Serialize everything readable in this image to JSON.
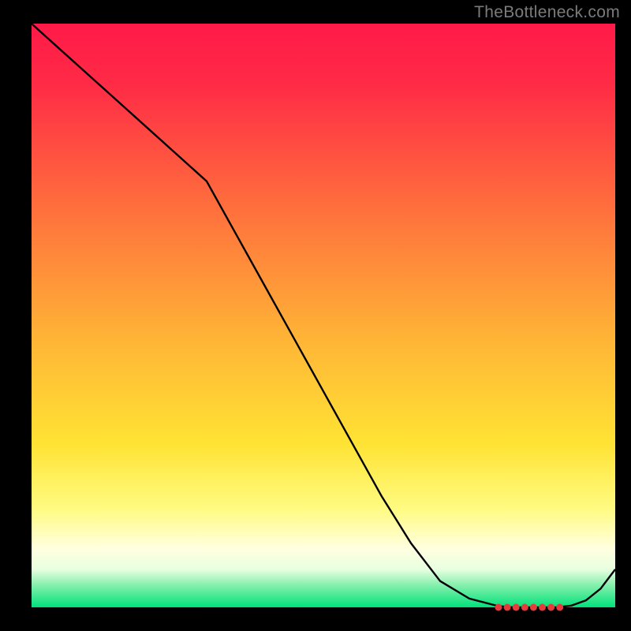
{
  "attribution": "TheBottleneck.com",
  "chart_data": {
    "type": "line",
    "title": "",
    "xlabel": "",
    "ylabel": "",
    "x": [
      0,
      5,
      10,
      15,
      20,
      25,
      30,
      35,
      40,
      45,
      50,
      55,
      60,
      65,
      70,
      75,
      80,
      82.5,
      85,
      87.5,
      90,
      92.5,
      95,
      97.5,
      100
    ],
    "y": [
      100,
      95.5,
      91,
      86.5,
      82,
      77.5,
      73,
      64,
      55,
      46,
      37,
      28,
      19,
      11,
      4.5,
      1.5,
      0.2,
      0,
      0,
      0,
      0,
      0.3,
      1.2,
      3.2,
      6.5
    ],
    "ylim": [
      0,
      100
    ],
    "xlim": [
      0,
      100
    ],
    "valley_markers_x": [
      80,
      81.5,
      83,
      84.5,
      86,
      87.5,
      89,
      90.5
    ],
    "valley_markers_y": 0,
    "marker_color": "#e63b3b",
    "curve_color": "#000000",
    "gradient_stops": [
      {
        "pos": 0.0,
        "color": "#ff1a48"
      },
      {
        "pos": 0.1,
        "color": "#ff2a46"
      },
      {
        "pos": 0.3,
        "color": "#ff6a3d"
      },
      {
        "pos": 0.55,
        "color": "#ffb736"
      },
      {
        "pos": 0.72,
        "color": "#ffe334"
      },
      {
        "pos": 0.83,
        "color": "#fffb80"
      },
      {
        "pos": 0.9,
        "color": "#ffffe0"
      },
      {
        "pos": 0.935,
        "color": "#e8ffe0"
      },
      {
        "pos": 0.96,
        "color": "#8df0b0"
      },
      {
        "pos": 1.0,
        "color": "#00e27a"
      }
    ]
  }
}
